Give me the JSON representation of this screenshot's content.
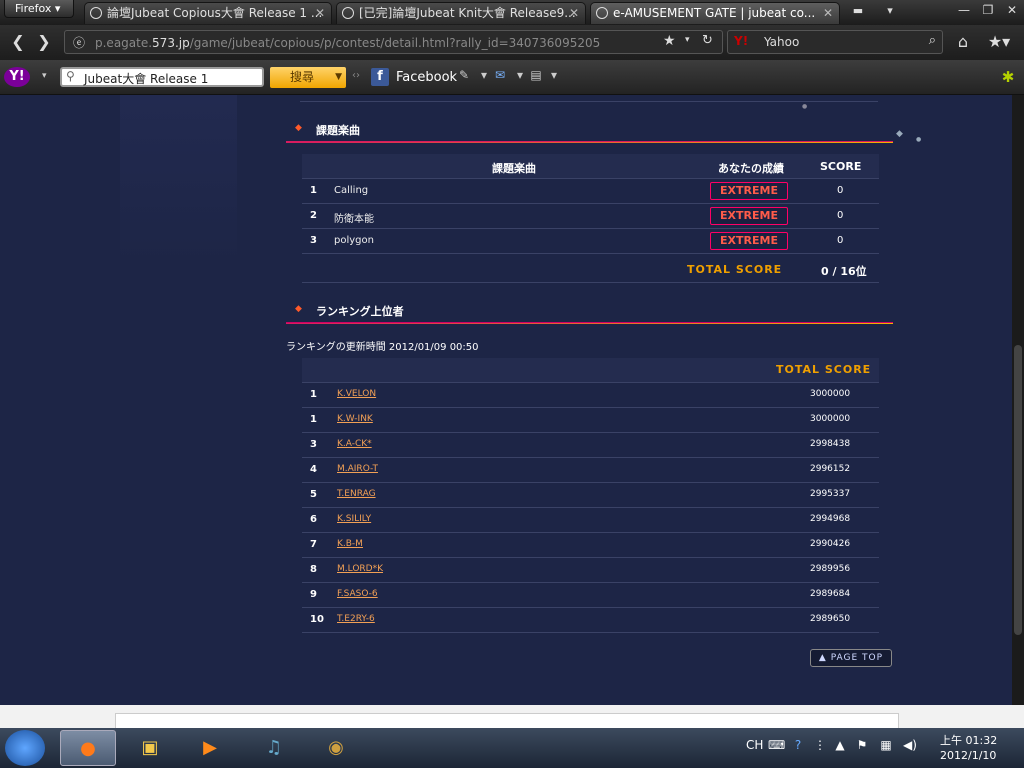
{
  "browser": {
    "menu_button": "Firefox",
    "tabs": [
      {
        "title": "論壇Jubeat Copious大會 Release 1 ..."
      },
      {
        "title": "[已完]論壇Jubeat Knit大會 Release9..."
      },
      {
        "title": "e-AMUSEMENT GATE | jubeat co..."
      }
    ],
    "url": {
      "prefix": "p.eagate.",
      "domain": "573.jp",
      "path": "/game/jubeat/copious/p/contest/detail.html?rally_id=340736095205"
    },
    "search_engine": "Yahoo"
  },
  "yahoo_toolbar": {
    "search_value": "Jubeat大會 Release 1",
    "search_button": "搜尋",
    "facebook_label": "Facebook"
  },
  "songs_section": {
    "title": "課題楽曲",
    "headers": {
      "song": "課題楽曲",
      "result": "あなたの成績",
      "score": "SCORE"
    },
    "rows": [
      {
        "num": "1",
        "song": "Calling",
        "result": "EXTREME",
        "score": "0"
      },
      {
        "num": "2",
        "song": "防衛本能",
        "result": "EXTREME",
        "score": "0"
      },
      {
        "num": "3",
        "song": "polygon",
        "result": "EXTREME",
        "score": "0"
      }
    ],
    "total_label": "TOTAL SCORE",
    "total_value": "0 / 16位"
  },
  "ranking_section": {
    "title": "ランキング上位者",
    "updated": "ランキングの更新時間 2012/01/09 00:50",
    "header_total": "TOTAL SCORE",
    "rows": [
      {
        "rank": "1",
        "name": "K.VELON",
        "score": "3000000"
      },
      {
        "rank": "1",
        "name": "K.W-INK",
        "score": "3000000"
      },
      {
        "rank": "3",
        "name": "K.A-CK*",
        "score": "2998438"
      },
      {
        "rank": "4",
        "name": "M.AIRO-T",
        "score": "2996152"
      },
      {
        "rank": "5",
        "name": "T.ENRAG",
        "score": "2995337"
      },
      {
        "rank": "6",
        "name": "K.SILILY",
        "score": "2994968"
      },
      {
        "rank": "7",
        "name": "K.B-M",
        "score": "2990426"
      },
      {
        "rank": "8",
        "name": "M.LORD*K",
        "score": "2989956"
      },
      {
        "rank": "9",
        "name": "F.SASO-6",
        "score": "2989684"
      },
      {
        "rank": "10",
        "name": "T.E2RY-6",
        "score": "2989650"
      }
    ]
  },
  "page_top": "▲ PAGE TOP",
  "taskbar": {
    "lang": "CH",
    "time": "上午 01:32",
    "date": "2012/1/10"
  }
}
